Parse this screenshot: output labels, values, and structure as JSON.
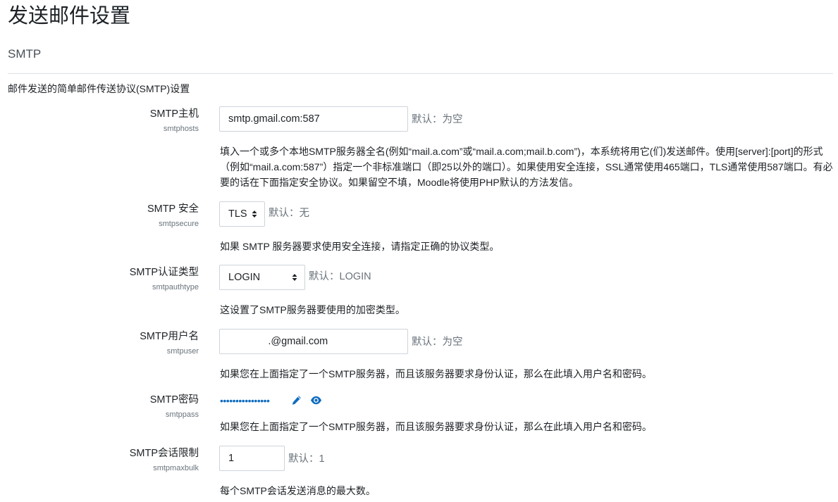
{
  "page": {
    "title": "发送邮件设置",
    "section": "SMTP",
    "section_description": "邮件发送的简单邮件传送协议(SMTP)设置"
  },
  "colors": {
    "accent": "#0f6cbf",
    "muted": "#6a737b",
    "border": "#ced4da"
  },
  "settings": {
    "smtphosts": {
      "label": "SMTP主机",
      "key": "smtphosts",
      "value": "smtp.gmail.com:587",
      "default": "默认：为空",
      "description": "填入一个或多个本地SMTP服务器全名(例如“mail.a.com”或“mail.a.com;mail.b.com”)，本系统将用它(们)发送邮件。使用[server]:[port]的形式（例如“mail.a.com:587”）指定一个非标准端口（即25以外的端口）。如果使用安全连接，SSL通常使用465端口，TLS通常使用587端口。有必要的话在下面指定安全协议。如果留空不填，Moodle将使用PHP默认的方法发信。"
    },
    "smtpsecure": {
      "label": "SMTP 安全",
      "key": "smtpsecure",
      "selected": "TLS",
      "default": "默认：无",
      "description": "如果 SMTP 服务器要求使用安全连接，请指定正确的协议类型。"
    },
    "smtpauthtype": {
      "label": "SMTP认证类型",
      "key": "smtpauthtype",
      "selected": "LOGIN",
      "default": "默认：LOGIN",
      "description": "这设置了SMTP服务器要使用的加密类型。"
    },
    "smtpuser": {
      "label": "SMTP用户名",
      "key": "smtpuser",
      "value": "              .@gmail.com",
      "default": "默认：为空",
      "description": "如果您在上面指定了一个SMTP服务器，而且该服务器要求身份认证，那么在此填入用户名和密码。"
    },
    "smtppass": {
      "label": "SMTP密码",
      "key": "smtppass",
      "masked_value": "••••••••••••••••",
      "edit_icon": "pencil-icon",
      "reveal_icon": "eye-icon",
      "description": "如果您在上面指定了一个SMTP服务器，而且该服务器要求身份认证，那么在此填入用户名和密码。"
    },
    "smtpmaxbulk": {
      "label": "SMTP会话限制",
      "key": "smtpmaxbulk",
      "value": "1",
      "default": "默认：1",
      "description": "每个SMTP会话发送消息的最大数。"
    }
  }
}
